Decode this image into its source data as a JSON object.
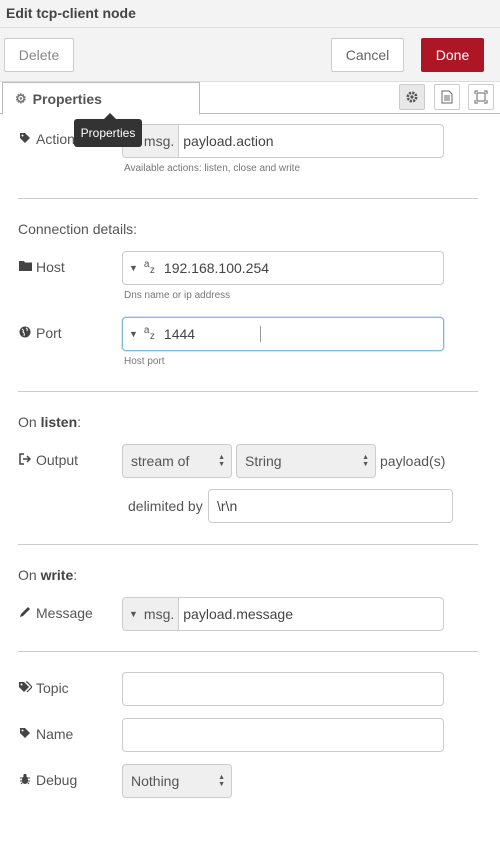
{
  "header": {
    "title": "Edit tcp-client node"
  },
  "toolbar": {
    "delete_label": "Delete",
    "cancel_label": "Cancel",
    "done_label": "Done"
  },
  "tabs": {
    "properties_label": "Properties",
    "tooltip": "Properties"
  },
  "action": {
    "label": "Action",
    "type_prefix": "msg.",
    "value": "payload.action",
    "hint": "Available actions: listen, close and write"
  },
  "connection": {
    "title": "Connection details:",
    "host": {
      "label": "Host",
      "value": "192.168.100.254",
      "hint": "Dns name or ip address"
    },
    "port": {
      "label": "Port",
      "value": "1444",
      "hint": "Host port"
    }
  },
  "listen": {
    "title_prefix": "On ",
    "title_bold": "listen",
    "title_suffix": ":",
    "output_label": "Output",
    "output_mode": "stream of",
    "output_type": "String",
    "output_suffix": "payload(s)",
    "delimited_label": "delimited by",
    "delimiter": "\\r\\n"
  },
  "write": {
    "title_prefix": "On ",
    "title_bold": "write",
    "title_suffix": ":",
    "message_label": "Message",
    "type_prefix": "msg.",
    "value": "payload.message"
  },
  "topic": {
    "label": "Topic",
    "value": ""
  },
  "name": {
    "label": "Name",
    "value": ""
  },
  "debug": {
    "label": "Debug",
    "value": "Nothing"
  },
  "colors": {
    "done_button": "#ad1625",
    "focus_border": "#85b7d9"
  },
  "icons": [
    "cog-icon",
    "tag-icon",
    "folder-icon",
    "globe-icon",
    "sign-in-icon",
    "pencil-icon",
    "tags-icon",
    "bug-icon",
    "file-icon",
    "expand-icon"
  ]
}
